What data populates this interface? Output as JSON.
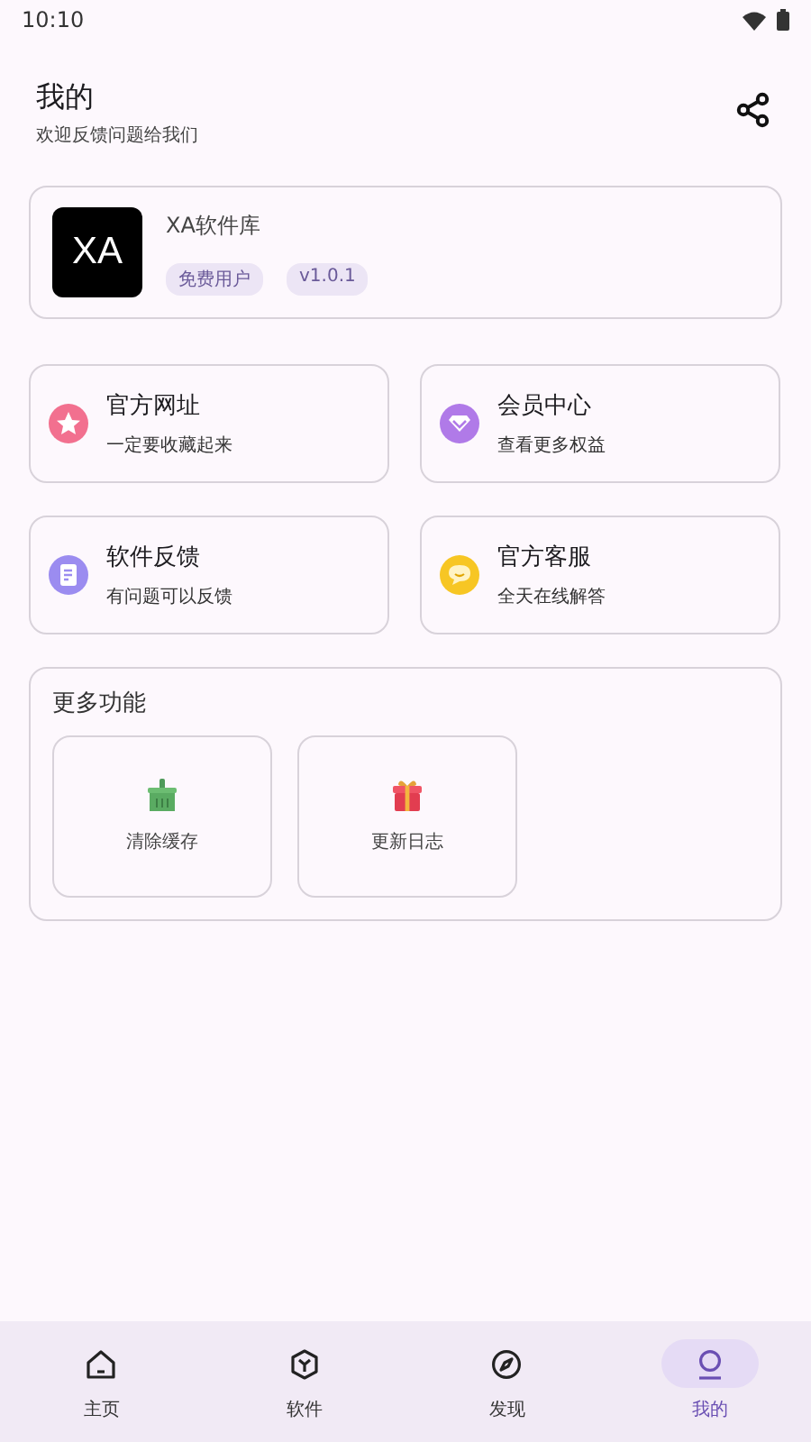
{
  "status_bar": {
    "time": "10:10"
  },
  "header": {
    "title": "我的",
    "subtitle": "欢迎反馈问题给我们"
  },
  "app_card": {
    "logo": "XA",
    "name": "XA软件库",
    "tags": [
      "免费用户",
      "v1.0.1"
    ]
  },
  "shortcuts": [
    {
      "kind": "star",
      "title": "官方网址",
      "subtitle": "一定要收藏起来"
    },
    {
      "kind": "vip",
      "title": "会员中心",
      "subtitle": "查看更多权益"
    },
    {
      "kind": "feedback",
      "title": "软件反馈",
      "subtitle": "有问题可以反馈"
    },
    {
      "kind": "chat",
      "title": "官方客服",
      "subtitle": "全天在线解答"
    }
  ],
  "more": {
    "title": "更多功能",
    "items": [
      {
        "kind": "broom",
        "label": "清除缓存"
      },
      {
        "kind": "gift",
        "label": "更新日志"
      }
    ]
  },
  "nav": [
    {
      "kind": "home",
      "label": "主页",
      "selected": false
    },
    {
      "kind": "cube",
      "label": "软件",
      "selected": false
    },
    {
      "kind": "compass",
      "label": "发现",
      "selected": false
    },
    {
      "kind": "user",
      "label": "我的",
      "selected": true
    }
  ]
}
